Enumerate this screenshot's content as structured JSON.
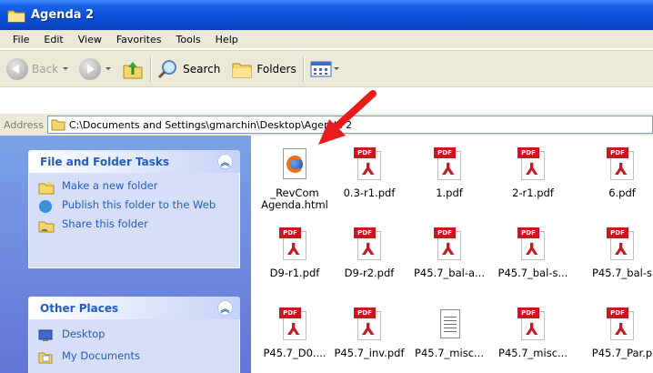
{
  "window": {
    "title": "Agenda 2"
  },
  "menu": [
    {
      "label": "File",
      "key": "F"
    },
    {
      "label": "Edit",
      "key": "E"
    },
    {
      "label": "View",
      "key": "V"
    },
    {
      "label": "Favorites",
      "key": "a"
    },
    {
      "label": "Tools",
      "key": "T"
    },
    {
      "label": "Help",
      "key": "H"
    }
  ],
  "toolbar": {
    "back_label": "Back",
    "search_label": "Search",
    "folders_label": "Folders"
  },
  "address": {
    "label": "Address",
    "path": "C:\\Documents and Settings\\gmarchin\\Desktop\\Agenda 2"
  },
  "tasks_panel": {
    "title": "File and Folder Tasks",
    "items": [
      {
        "label": "Make a new folder",
        "icon": "new-folder-icon"
      },
      {
        "label": "Publish this folder to the Web",
        "icon": "publish-web-icon"
      },
      {
        "label": "Share this folder",
        "icon": "share-folder-icon"
      }
    ]
  },
  "other_panel": {
    "title": "Other Places",
    "items": [
      {
        "label": "Desktop",
        "icon": "desktop-icon"
      },
      {
        "label": "My Documents",
        "icon": "my-documents-icon"
      }
    ]
  },
  "files": [
    {
      "name": "_RevCom Agenda.html",
      "type": "html"
    },
    {
      "name": "0.3-r1.pdf",
      "type": "pdf"
    },
    {
      "name": "1.pdf",
      "type": "pdf"
    },
    {
      "name": "2-r1.pdf",
      "type": "pdf"
    },
    {
      "name": "6.pdf",
      "type": "pdf"
    },
    {
      "name": "D9-r1.pdf",
      "type": "pdf"
    },
    {
      "name": "D9-r2.pdf",
      "type": "pdf"
    },
    {
      "name": "P45.7_bal-a...",
      "type": "pdf"
    },
    {
      "name": "P45.7_bal-s...",
      "type": "pdf"
    },
    {
      "name": "P45.7_bal-s",
      "type": "pdf"
    },
    {
      "name": "P45.7_D0....",
      "type": "pdf"
    },
    {
      "name": "P45.7_inv.pdf",
      "type": "pdf"
    },
    {
      "name": "P45.7_misc...",
      "type": "txt"
    },
    {
      "name": "P45.7_misc...",
      "type": "pdf"
    },
    {
      "name": "P45.7_Par.p",
      "type": "pdf"
    }
  ],
  "pdf_badge": "PDF",
  "colors": {
    "titlebar": "#0a4fd9",
    "task_link": "#215dc6",
    "pdf_red": "#c9171e",
    "annotation_arrow": "#e81c1c"
  }
}
